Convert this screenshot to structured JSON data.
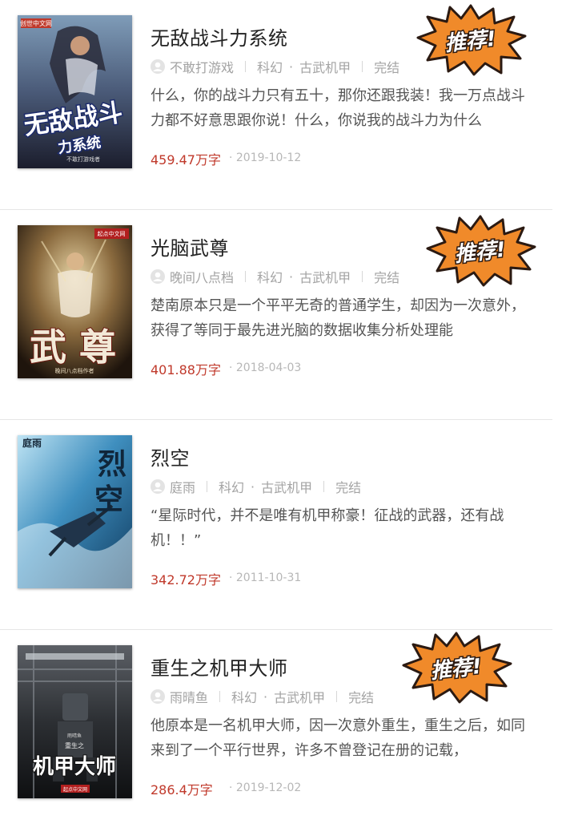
{
  "books": [
    {
      "title": "无敌战斗力系统",
      "author": "不敢打游戏",
      "category": "科幻",
      "subcategory": "古武机甲",
      "status": "完结",
      "description": "什么，你的战斗力只有五十，那你还跟我装！我一万点战斗力都不好意思跟你说！什么，你说我的战斗力为什么",
      "word_count": "459.47万字",
      "date": "· 2019-10-12",
      "badge": "推荐!",
      "cover_text": {
        "publisher": "创世中文网",
        "line1": "无敌战斗",
        "line2": "力系统",
        "author": "不敢打游戏者"
      }
    },
    {
      "title": "光脑武尊",
      "author": "晚间八点档",
      "category": "科幻",
      "subcategory": "古武机甲",
      "status": "完结",
      "description": "楚南原本只是一个平平无奇的普通学生，却因为一次意外，获得了等同于最先进光脑的数据收集分析处理能",
      "word_count": "401.88万字",
      "date": "· 2018-04-03",
      "badge": "推荐!",
      "cover_text": {
        "publisher": "起点中文网",
        "line1": "武",
        "line2": "尊",
        "author": "晚间八点档作者"
      }
    },
    {
      "title": "烈空",
      "author": "庭雨",
      "category": "科幻",
      "subcategory": "古武机甲",
      "status": "完结",
      "description": "“星际时代，并不是唯有机甲称豪！征战的武器，还有战机！！”",
      "word_count": "342.72万字",
      "date": "· 2011-10-31",
      "badge": "",
      "cover_text": {
        "publisher": "庭雨",
        "line1": "烈",
        "line2": "空",
        "author": ""
      }
    },
    {
      "title": "重生之机甲大师",
      "author": "雨晴鱼",
      "category": "科幻",
      "subcategory": "古武机甲",
      "status": "完结",
      "description": "他原本是一名机甲大师，因一次意外重生，重生之后，如同来到了一个平行世界，许多不曾登记在册的记载，",
      "word_count": "286.4万字",
      "date": "· 2019-12-02",
      "badge": "推荐!",
      "cover_text": {
        "publisher": "起点中文网",
        "line1": "机甲大师",
        "line2": "重生之",
        "author": "雨晴鱼"
      }
    }
  ],
  "colors": {
    "count": "#c0392b",
    "badge_fill": "#f08a2a",
    "badge_outline": "#2b1a12",
    "meta": "#a3a3a3",
    "divider": "#e6e6e6"
  },
  "icons": {
    "author_avatar": "user-avatar-icon",
    "badge": "starburst-badge-icon"
  }
}
